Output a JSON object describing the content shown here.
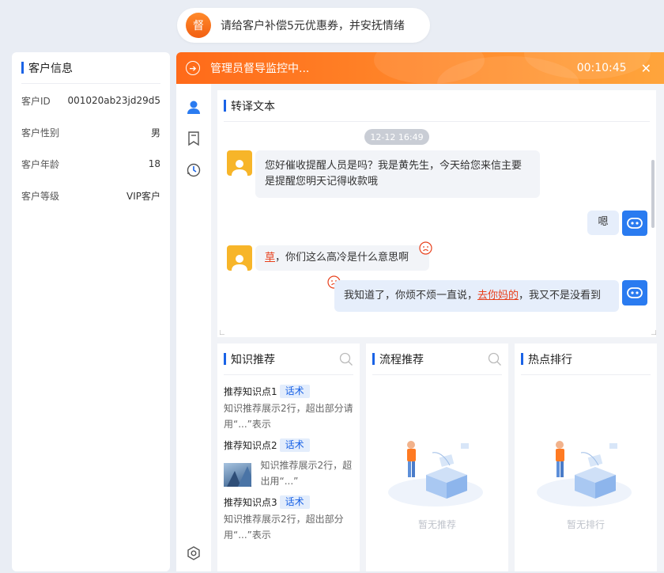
{
  "tip": {
    "badge": "督",
    "text": "请给客户补偿5元优惠券，并安抚情绪"
  },
  "customer": {
    "title": "客户信息",
    "rows": [
      {
        "label": "客户ID",
        "value": "001020ab23jd29d5"
      },
      {
        "label": "客户性别",
        "value": "男"
      },
      {
        "label": "客户年龄",
        "value": "18"
      },
      {
        "label": "客户等级",
        "value": "VIP客户"
      }
    ]
  },
  "header": {
    "title": "管理员督导监控中...",
    "timer": "00:10:45",
    "close": "✕"
  },
  "transcript": {
    "title": "转译文本",
    "timestamp": "12-12 16:49",
    "messages": [
      {
        "from": "customer",
        "text": "您好催收提醒人员是吗？我是黄先生，今天给您来信主要是提醒您明天记得收款哦"
      },
      {
        "from": "agent",
        "text": "嗯"
      },
      {
        "from": "customer",
        "bad": "草",
        "rest": "，你们这么高冷是什么意思啊"
      },
      {
        "from": "agent",
        "pre": "我知道了，你烦不烦一直说，",
        "bad": "去你妈的",
        "post": "，我又不是没看到"
      }
    ]
  },
  "knowledge": {
    "title": "知识推荐",
    "items": [
      {
        "name": "推荐知识点1",
        "tag": "话术",
        "text": "知识推荐展示2行，超出部分请用“...”表示"
      },
      {
        "name": "推荐知识点2",
        "tag": "话术",
        "text": "知识推荐展示2行，超出用“...”"
      },
      {
        "name": "推荐知识点3",
        "tag": "话术",
        "text": "知识推荐展示2行，超出部分用“...”表示"
      }
    ]
  },
  "process": {
    "title": "流程推荐",
    "empty": "暂无推荐"
  },
  "hot": {
    "title": "热点排行",
    "empty": "暂无排行"
  },
  "colors": {
    "accent": "#1a63e6",
    "orange": "#ff7a22",
    "warn": "#e8401c"
  }
}
